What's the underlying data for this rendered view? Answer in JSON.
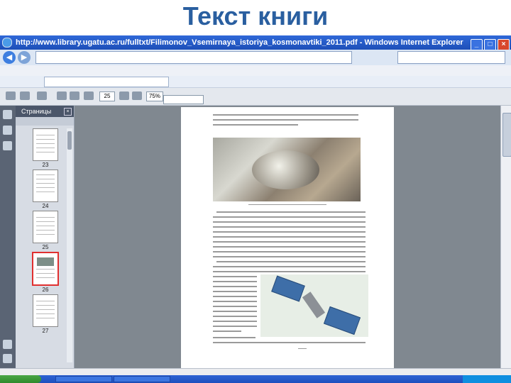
{
  "slide": {
    "title": "Текст книги"
  },
  "window": {
    "title": "http://www.library.ugatu.ac.ru/fulltxt/Filimonov_Vsemirnaya_istoriya_kosmonavtiki_2011.pdf - Windows Internet Explorer"
  },
  "pdf": {
    "panel_title": "Страницы",
    "zoom": "75%",
    "page_number": "25",
    "thumb_labels": [
      "23",
      "24",
      "25",
      "26",
      "27"
    ],
    "selected_thumb": 3
  },
  "colors": {
    "slide_title": "#2a5fa0",
    "titlebar": "#2f68d8",
    "start_button": "#4aa645",
    "selected_thumb": "#e03030"
  },
  "icons": [
    "ie-icon",
    "back-icon",
    "forward-icon",
    "print-icon",
    "save-icon",
    "pages-icon",
    "bookmark-icon",
    "attachment-icon",
    "close-icon"
  ]
}
